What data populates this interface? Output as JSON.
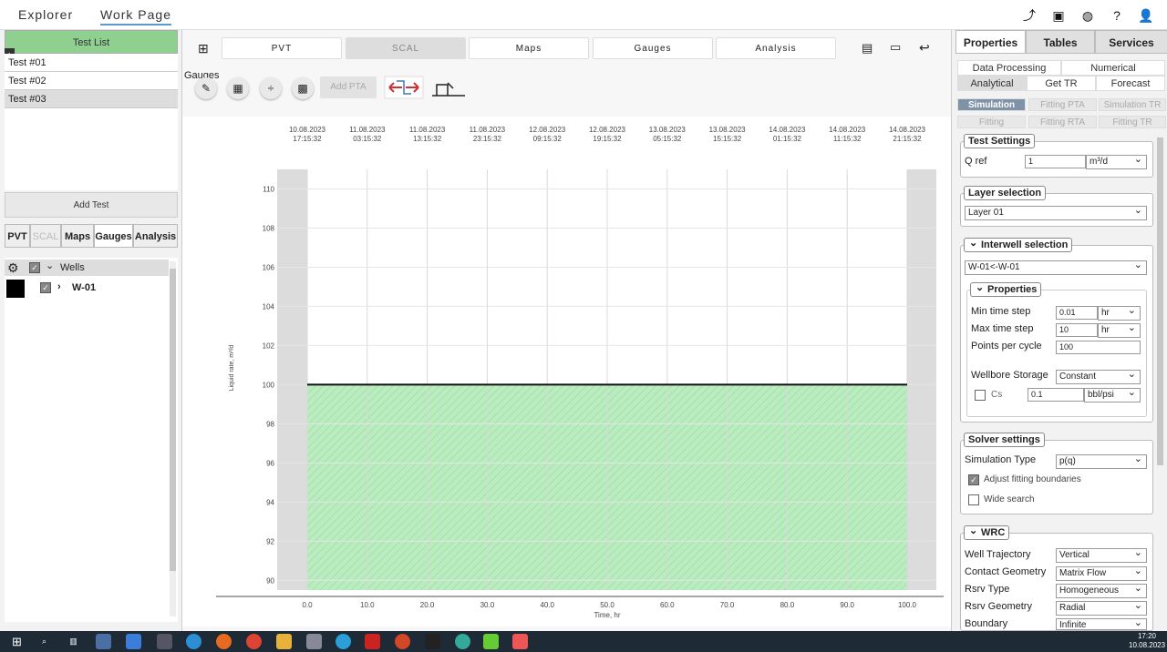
{
  "topbar": {
    "tabs": [
      "Explorer",
      "Work Page"
    ],
    "icons": [
      "share-icon",
      "save-icon",
      "globe-icon",
      "help-icon",
      "user-icon"
    ]
  },
  "left": {
    "header": "Test List",
    "tests": [
      "Test #01",
      "Test #02",
      "Test #03"
    ],
    "add_test": "Add Test",
    "tabs": [
      "PVT",
      "SCAL",
      "Maps",
      "Gauges",
      "Analysis"
    ],
    "tree": {
      "root": "Wells",
      "child": "W-01"
    }
  },
  "main": {
    "tabs": [
      "PVT",
      "SCAL",
      "Maps",
      "Gauges",
      "Analysis"
    ],
    "gauges_label": "Gauges",
    "add_pta": "Add PTA"
  },
  "right": {
    "tabs": [
      "Properties",
      "Tables",
      "Services"
    ],
    "subtabs": [
      "Data Processing",
      "Numerical",
      "Analytical",
      "Get TR",
      "Forecast"
    ],
    "simtabs": [
      "Simulation",
      "Fitting PTA",
      "Simulation TR",
      "Fitting",
      "Fitting RTA",
      "Fitting TR"
    ],
    "test_settings": {
      "title": "Test Settings",
      "qref_label": "Q ref",
      "qref_value": "1",
      "qref_unit": "m³/d"
    },
    "layer": {
      "title": "Layer selection",
      "value": "Layer 01"
    },
    "interwell": {
      "title": "Interwell selection",
      "value": "W-01<-W-01"
    },
    "properties": {
      "title": "Properties",
      "min_ts_label": "Min time step",
      "min_ts": "0.01",
      "min_ts_unit": "hr",
      "max_ts_label": "Max time step",
      "max_ts": "10",
      "max_ts_unit": "hr",
      "ppc_label": "Points per cycle",
      "ppc": "100",
      "wbs_label": "Wellbore Storage",
      "wbs": "Constant",
      "cs_label": "Cs",
      "cs": "0.1",
      "cs_unit": "bbl/psi"
    },
    "solver": {
      "title": "Solver settings",
      "type_label": "Simulation Type",
      "type": "p(q)",
      "adjust": "Adjust fitting boundaries",
      "wide": "Wide search"
    },
    "wrc": {
      "title": "WRC",
      "rows": [
        {
          "label": "Well Trajectory",
          "value": "Vertical"
        },
        {
          "label": "Contact Geometry",
          "value": "Matrix Flow"
        },
        {
          "label": "Rsrv Type",
          "value": "Homogeneous"
        },
        {
          "label": "Rsrv Geometry",
          "value": "Radial"
        },
        {
          "label": "Boundary",
          "value": "Infinite"
        }
      ]
    }
  },
  "taskbar": {
    "time": "17:20",
    "date": "10.08.2023"
  },
  "chart_data": {
    "type": "area",
    "title": "",
    "ylabel": "Liquid rate, m³/d",
    "xlabel": "Time, hr",
    "x": [
      0,
      100
    ],
    "y": [
      100,
      100
    ],
    "xlim": [
      0,
      100
    ],
    "ylim": [
      89.5,
      111
    ],
    "xticks": [
      "0.0",
      "10.0",
      "20.0",
      "30.0",
      "40.0",
      "50.0",
      "60.0",
      "70.0",
      "80.0",
      "90.0",
      "100.0"
    ],
    "yticks": [
      "90",
      "92",
      "94",
      "96",
      "98",
      "100",
      "102",
      "104",
      "106",
      "108",
      "110"
    ],
    "top_axis": [
      [
        "10.08.2023",
        "17:15:32"
      ],
      [
        "11.08.2023",
        "03:15:32"
      ],
      [
        "11.08.2023",
        "13:15:32"
      ],
      [
        "11.08.2023",
        "23:15:32"
      ],
      [
        "12.08.2023",
        "09:15:32"
      ],
      [
        "12.08.2023",
        "19:15:32"
      ],
      [
        "13.08.2023",
        "05:15:32"
      ],
      [
        "13.08.2023",
        "15:15:32"
      ],
      [
        "14.08.2023",
        "01:15:32"
      ],
      [
        "14.08.2023",
        "11:15:32"
      ],
      [
        "14.08.2023",
        "21:15:32"
      ]
    ],
    "fill_color": "#b9ecbf",
    "line_color": "#111111",
    "grid": true
  }
}
